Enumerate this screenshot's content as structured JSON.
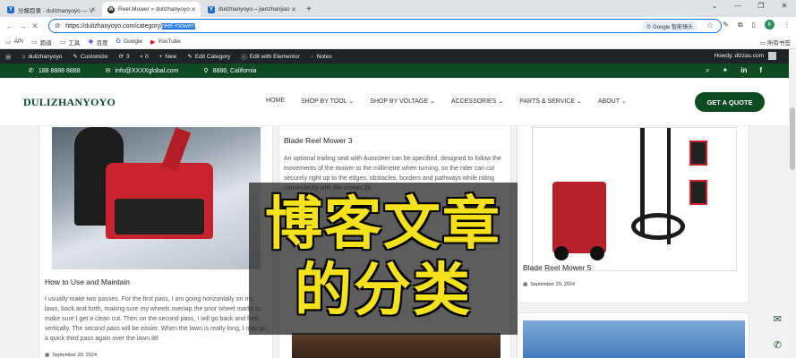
{
  "browser": {
    "tabs": [
      {
        "label": "分類目录 - dulizhanyoyo — V",
        "favicon": "Y"
      },
      {
        "label": "Reel Mower « dulizhanyoyo",
        "favicon": "W"
      },
      {
        "label": "dulizhanyoyo – jianzhanjiao",
        "favicon": "Y"
      }
    ],
    "new_tab": "+",
    "url_prefix": "https://dulizhanyoyo.com/category/",
    "url_selected": "reel-mower/",
    "translate_label": "Google 智能镜头",
    "profile_initial": "K",
    "bookmarks": [
      {
        "label": "API",
        "icon": "▭"
      },
      {
        "label": "跑道",
        "icon": "▭"
      },
      {
        "label": "工具",
        "icon": "▭"
      },
      {
        "label": "百度",
        "icon": "❖"
      },
      {
        "label": "Google",
        "icon": "G"
      },
      {
        "label": "YouTube",
        "icon": "▶"
      }
    ],
    "all_bookmarks": "所有书签"
  },
  "wp_admin": {
    "items": [
      "dulizhanyoyo",
      "Customize",
      "3",
      "0",
      "New",
      "Edit Category",
      "Edit with Elementor",
      "Notes"
    ],
    "howdy": "Howdy, dlzzas.com"
  },
  "topbar": {
    "phone": "188 8888 8888",
    "email": "info@XXXXglobal.com",
    "address": "8888, California"
  },
  "header": {
    "logo": "DULIZHANYOYO",
    "nav": [
      "HOME",
      "SHOP BY TOOL ⌄",
      "SHOP BY VOLTAGE ⌄",
      "ACCESSORIES ⌄",
      "PARTS & SERVICE ⌄",
      "ABOUT ⌄"
    ],
    "cta": "GET A QUOTE"
  },
  "posts": [
    {
      "title": "How to Use and Maintain",
      "excerpt": "I usually make two passes. For the first pass, I am going horizontally on my lawn, back and forth, making sure my wheels overlap the prior wheel marks to make sure I get a clean cut. Then on the second pass, I will go back and forth vertically. The second pass will be easier. When the lawn is really long, I may go a quick third pass again over the lawn.88",
      "date": "September 20, 2024"
    },
    {
      "title": "Blade Reel Mower 3",
      "excerpt": "An optional trailing seat with Autosteer can be specified, designed to follow the movements of the mower to the millimetre when turning, so the rider can cut securely right up to the edges, obstacles, borders and pathways while riding conveniently with the mower.88"
    },
    {
      "title": "Blade Reel Mower 5",
      "date": "September 20, 2024"
    }
  ],
  "overlay": {
    "line1": "博客文章",
    "line2": "的分类"
  },
  "colors": {
    "brand_green": "#0e4a24",
    "overlay_text": "#f6e21a"
  }
}
